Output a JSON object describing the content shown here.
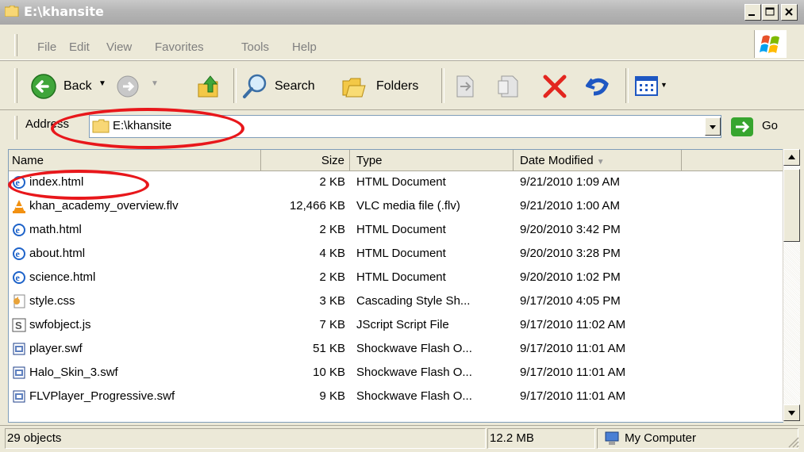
{
  "window": {
    "title": "E:\\khansite"
  },
  "menu": [
    "File",
    "Edit",
    "View",
    "Favorites",
    "Tools",
    "Help"
  ],
  "toolbar": {
    "back": "Back",
    "search": "Search",
    "folders": "Folders"
  },
  "address": {
    "label": "Address",
    "value": "E:\\khansite",
    "go": "Go"
  },
  "columns": [
    "Name",
    "Size",
    "Type",
    "Date Modified"
  ],
  "files": [
    {
      "name": "index.html",
      "size": "2 KB",
      "type": "HTML Document",
      "date": "9/21/2010 1:09 AM",
      "icon": "ie-icon"
    },
    {
      "name": "khan_academy_overview.flv",
      "size": "12,466 KB",
      "type": "VLC media file (.flv)",
      "date": "9/21/2010 1:00 AM",
      "icon": "vlc-icon"
    },
    {
      "name": "math.html",
      "size": "2 KB",
      "type": "HTML Document",
      "date": "9/20/2010 3:42 PM",
      "icon": "ie-icon"
    },
    {
      "name": "about.html",
      "size": "4 KB",
      "type": "HTML Document",
      "date": "9/20/2010 3:28 PM",
      "icon": "ie-icon"
    },
    {
      "name": "science.html",
      "size": "2 KB",
      "type": "HTML Document",
      "date": "9/20/2010 1:02 PM",
      "icon": "ie-icon"
    },
    {
      "name": "style.css",
      "size": "3 KB",
      "type": "Cascading Style Sh...",
      "date": "9/17/2010 4:05 PM",
      "icon": "css-icon"
    },
    {
      "name": "swfobject.js",
      "size": "7 KB",
      "type": "JScript Script File",
      "date": "9/17/2010 11:02 AM",
      "icon": "script-icon"
    },
    {
      "name": "player.swf",
      "size": "51 KB",
      "type": "Shockwave Flash O...",
      "date": "9/17/2010 11:01 AM",
      "icon": "swf-icon"
    },
    {
      "name": "Halo_Skin_3.swf",
      "size": "10 KB",
      "type": "Shockwave Flash O...",
      "date": "9/17/2010 11:01 AM",
      "icon": "swf-icon"
    },
    {
      "name": "FLVPlayer_Progressive.swf",
      "size": "9 KB",
      "type": "Shockwave Flash O...",
      "date": "9/17/2010 11:01 AM",
      "icon": "swf-icon"
    }
  ],
  "status": {
    "objects": "29 objects",
    "size": "12.2 MB",
    "location": "My Computer"
  },
  "colors": {
    "annotation": "#e8171b",
    "title_bar": "#b5b5b5",
    "selection_blue": "#316ac5"
  }
}
